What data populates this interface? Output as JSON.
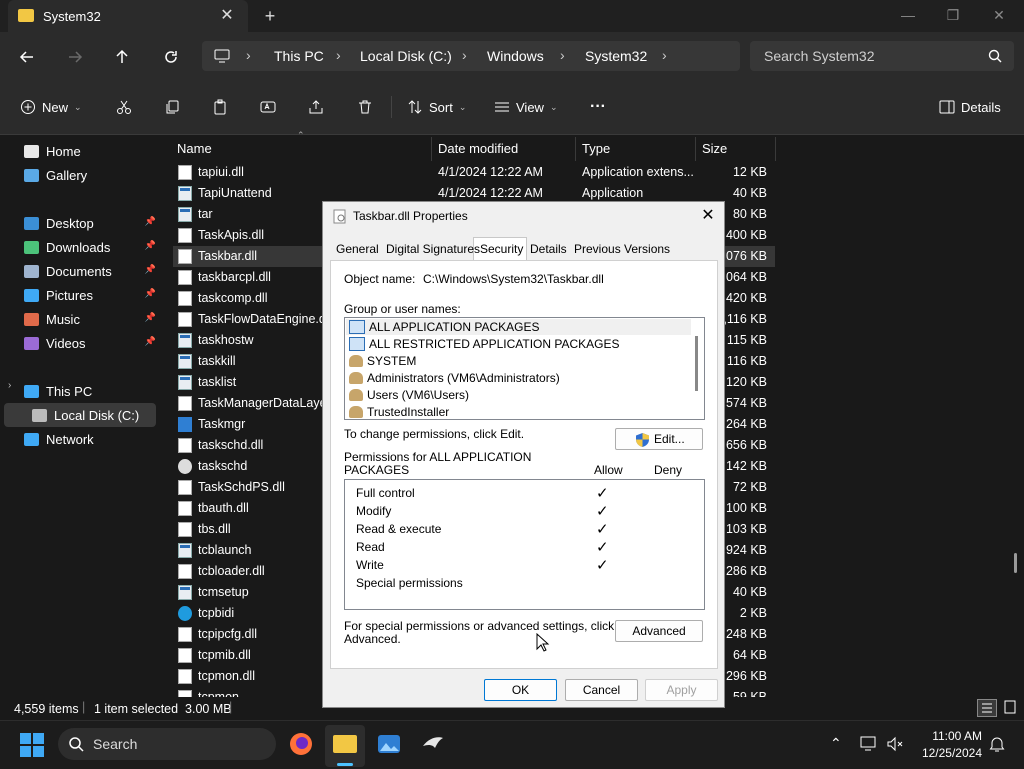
{
  "window": {
    "tab_title": "System32",
    "close_tab": "✕",
    "new_tab": "+"
  },
  "address": {
    "crumbs": [
      "This PC",
      "Local Disk (C:)",
      "Windows",
      "System32"
    ],
    "search_placeholder": "Search System32"
  },
  "commands": {
    "new": "New",
    "sort": "Sort",
    "view": "View",
    "more": "···",
    "details": "Details"
  },
  "nav": {
    "items": [
      {
        "label": "Home",
        "icon": "home-icon"
      },
      {
        "label": "Gallery",
        "icon": "gallery-icon"
      },
      {
        "label": "Desktop",
        "icon": "desktop-folder-icon"
      },
      {
        "label": "Downloads",
        "icon": "downloads-icon"
      },
      {
        "label": "Documents",
        "icon": "documents-icon"
      },
      {
        "label": "Pictures",
        "icon": "pictures-icon"
      },
      {
        "label": "Music",
        "icon": "music-icon"
      },
      {
        "label": "Videos",
        "icon": "videos-icon"
      },
      {
        "label": "This PC",
        "icon": "this-pc-icon"
      },
      {
        "label": "Local Disk (C:)",
        "icon": "drive-icon"
      },
      {
        "label": "Network",
        "icon": "network-icon"
      }
    ]
  },
  "columns": {
    "name": "Name",
    "date": "Date modified",
    "type": "Type",
    "size": "Size"
  },
  "files": [
    {
      "name": "tapiui.dll",
      "date": "4/1/2024 12:22 AM",
      "type": "Application extens...",
      "size": "12 KB",
      "kind": "dll"
    },
    {
      "name": "TapiUnattend",
      "date": "4/1/2024 12:22 AM",
      "type": "Application",
      "size": "40 KB",
      "kind": "app"
    },
    {
      "name": "tar",
      "date": "",
      "type": "",
      "size": "80 KB",
      "kind": "app"
    },
    {
      "name": "TaskApis.dll",
      "date": "",
      "type": "",
      "size": "400 KB",
      "kind": "dll"
    },
    {
      "name": "Taskbar.dll",
      "date": "",
      "type": "",
      "size": "3,076 KB",
      "kind": "dll"
    },
    {
      "name": "taskbarcpl.dll",
      "date": "",
      "type": "",
      "size": "1,064 KB",
      "kind": "dll"
    },
    {
      "name": "taskcomp.dll",
      "date": "",
      "type": "",
      "size": "420 KB",
      "kind": "dll"
    },
    {
      "name": "TaskFlowDataEngine.dll",
      "date": "",
      "type": "",
      "size": "1,116 KB",
      "kind": "dll"
    },
    {
      "name": "taskhostw",
      "date": "",
      "type": "",
      "size": "115 KB",
      "kind": "app"
    },
    {
      "name": "taskkill",
      "date": "",
      "type": "",
      "size": "116 KB",
      "kind": "app"
    },
    {
      "name": "tasklist",
      "date": "",
      "type": "",
      "size": "120 KB",
      "kind": "app"
    },
    {
      "name": "TaskManagerDataLayer.dll",
      "date": "",
      "type": "",
      "size": "574 KB",
      "kind": "dll"
    },
    {
      "name": "Taskmgr",
      "date": "",
      "type": "",
      "size": "6,264 KB",
      "kind": "taskmgr"
    },
    {
      "name": "taskschd.dll",
      "date": "",
      "type": "",
      "size": "656 KB",
      "kind": "dll"
    },
    {
      "name": "taskschd",
      "date": "",
      "type": "",
      "size": "142 KB",
      "kind": "clock"
    },
    {
      "name": "TaskSchdPS.dll",
      "date": "",
      "type": "",
      "size": "72 KB",
      "kind": "dll"
    },
    {
      "name": "tbauth.dll",
      "date": "",
      "type": "",
      "size": "100 KB",
      "kind": "dll"
    },
    {
      "name": "tbs.dll",
      "date": "",
      "type": "",
      "size": "103 KB",
      "kind": "dll"
    },
    {
      "name": "tcblaunch",
      "date": "",
      "type": "",
      "size": "924 KB",
      "kind": "app"
    },
    {
      "name": "tcbloader.dll",
      "date": "",
      "type": "",
      "size": "286 KB",
      "kind": "dll"
    },
    {
      "name": "tcmsetup",
      "date": "",
      "type": "",
      "size": "40 KB",
      "kind": "app"
    },
    {
      "name": "tcpbidi",
      "date": "",
      "type": "",
      "size": "2 KB",
      "kind": "edge"
    },
    {
      "name": "tcpipcfg.dll",
      "date": "",
      "type": "",
      "size": "248 KB",
      "kind": "dll"
    },
    {
      "name": "tcpmib.dll",
      "date": "",
      "type": "",
      "size": "64 KB",
      "kind": "dll"
    },
    {
      "name": "tcpmon.dll",
      "date": "",
      "type": "",
      "size": "296 KB",
      "kind": "dll"
    },
    {
      "name": "tcpmon...",
      "date": "",
      "type": "",
      "size": "59 KB",
      "kind": "dll"
    }
  ],
  "status": {
    "count": "4,559 items",
    "selected": "1 item selected  3.00 MB"
  },
  "taskbar": {
    "search": "Search",
    "time": "11:00 AM",
    "date": "12/25/2024"
  },
  "dialog": {
    "title": "Taskbar.dll Properties",
    "tabs": [
      "General",
      "Digital Signatures",
      "Security",
      "Details",
      "Previous Versions"
    ],
    "object_label": "Object name:",
    "object_value": "C:\\Windows\\System32\\Taskbar.dll",
    "group_label": "Group or user names:",
    "groups": [
      "ALL APPLICATION PACKAGES",
      "ALL RESTRICTED APPLICATION PACKAGES",
      "SYSTEM",
      "Administrators (VM6\\Administrators)",
      "Users (VM6\\Users)",
      "TrustedInstaller"
    ],
    "change_text": "To change permissions, click Edit.",
    "edit_button": "Edit...",
    "perm_label_1": "Permissions for ALL APPLICATION",
    "perm_label_2": "PACKAGES",
    "allow": "Allow",
    "deny": "Deny",
    "permissions": [
      {
        "name": "Full control",
        "allow": true
      },
      {
        "name": "Modify",
        "allow": true
      },
      {
        "name": "Read & execute",
        "allow": true
      },
      {
        "name": "Read",
        "allow": true
      },
      {
        "name": "Write",
        "allow": true
      },
      {
        "name": "Special permissions",
        "allow": false
      }
    ],
    "check": "✓",
    "special_text_1": "For special permissions or advanced settings, click",
    "special_text_2": "Advanced.",
    "advanced_button": "Advanced",
    "ok": "OK",
    "cancel": "Cancel",
    "apply": "Apply"
  }
}
